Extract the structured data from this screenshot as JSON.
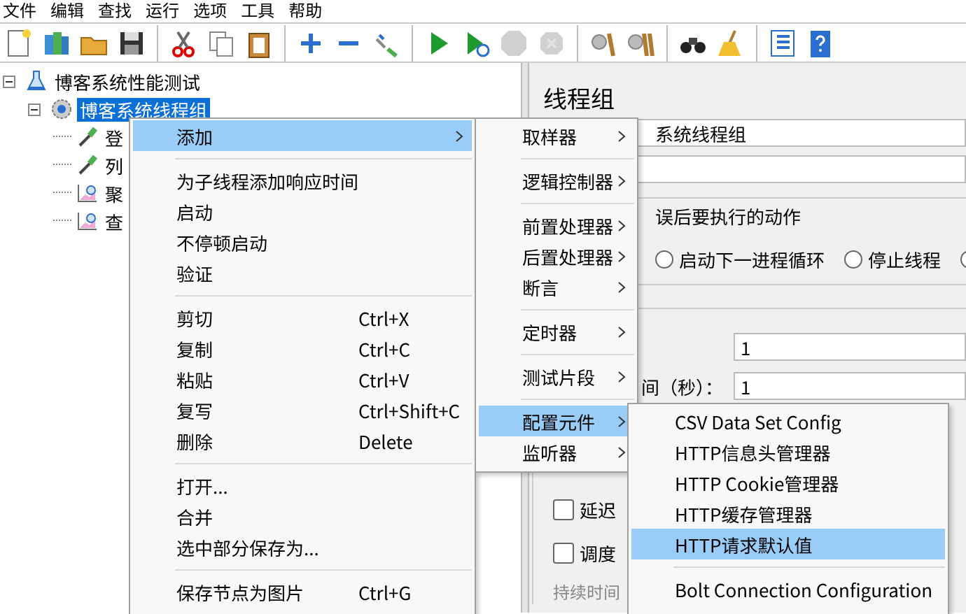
{
  "menu_bar": [
    "文件",
    "编辑",
    "查找",
    "运行",
    "选项",
    "工具",
    "帮助"
  ],
  "toolbar": [
    {
      "disabled": false
    },
    {
      "disabled": false
    },
    {
      "disabled": false
    },
    {
      "disabled": false
    },
    {
      "disabled": false
    },
    {
      "disabled": false
    },
    {
      "disabled": false
    },
    {
      "disabled": false
    },
    {
      "disabled": false
    },
    {
      "disabled": false
    },
    {
      "disabled": false
    },
    {
      "disabled": false
    },
    {
      "disabled": true
    },
    {
      "disabled": true
    },
    {
      "disabled": false
    },
    {
      "disabled": false
    },
    {
      "disabled": false
    },
    {
      "disabled": false
    },
    {
      "disabled": false
    },
    {
      "disabled": false
    }
  ],
  "tree": [
    {
      "kind": "test-plan",
      "label": "博客系统性能测试",
      "expanded": true,
      "selected": false,
      "children": [
        {
          "kind": "thread-group",
          "label": "博客系统线程组",
          "expanded": true,
          "selected": true,
          "children": [
            {
              "kind": "sampler",
              "label": "登",
              "selected": false
            },
            {
              "kind": "sampler",
              "label": "列",
              "selected": false
            },
            {
              "kind": "listener",
              "label": "聚",
              "selected": false
            },
            {
              "kind": "listener",
              "label": "查",
              "selected": false
            }
          ]
        }
      ]
    }
  ],
  "panel": {
    "title": "线程组",
    "name_value": "系统线程组",
    "error_group_title": "误后要执行的动作",
    "radios": [
      {
        "label": "启动下一进程循环",
        "selected": false
      },
      {
        "label": "停止线程",
        "selected": false
      },
      {
        "selected": false
      }
    ],
    "thread_count_value": "1",
    "ramp_label": "间（秒）：",
    "ramp_value": "1",
    "checkboxes": [
      {
        "label": "延迟",
        "checked": false
      },
      {
        "label": "调度",
        "checked": false
      }
    ],
    "duration_label": "持续时间"
  },
  "context_menu": {
    "items": [
      {
        "kind": "item",
        "label": "添加",
        "has_submenu": true,
        "selected": true
      },
      {
        "kind": "separator"
      },
      {
        "kind": "item",
        "label": "为子线程添加响应时间",
        "selected": false
      },
      {
        "kind": "item",
        "label": "启动",
        "selected": false
      },
      {
        "kind": "item",
        "label": "不停顿启动",
        "selected": false
      },
      {
        "kind": "item",
        "label": "验证",
        "selected": false
      },
      {
        "kind": "separator"
      },
      {
        "kind": "item",
        "label": "剪切",
        "shortcut": "Ctrl+X",
        "selected": false
      },
      {
        "kind": "item",
        "label": "复制",
        "shortcut": "Ctrl+C",
        "selected": false
      },
      {
        "kind": "item",
        "label": "粘贴",
        "shortcut": "Ctrl+V",
        "selected": false
      },
      {
        "kind": "item",
        "label": "复写",
        "shortcut": "Ctrl+Shift+C",
        "selected": false
      },
      {
        "kind": "item",
        "label": "删除",
        "shortcut": "Delete",
        "selected": false
      },
      {
        "kind": "separator"
      },
      {
        "kind": "item",
        "label": "打开...",
        "selected": false
      },
      {
        "kind": "item",
        "label": "合并",
        "selected": false
      },
      {
        "kind": "item",
        "label": "选中部分保存为...",
        "selected": false
      },
      {
        "kind": "separator"
      },
      {
        "kind": "item",
        "label": "保存节点为图片",
        "shortcut": "Ctrl+G",
        "selected": false
      }
    ]
  },
  "add_submenu": {
    "items": [
      {
        "kind": "item",
        "label": "取样器",
        "has_submenu": true,
        "selected": false
      },
      {
        "kind": "separator"
      },
      {
        "kind": "item",
        "label": "逻辑控制器",
        "has_submenu": true,
        "selected": false
      },
      {
        "kind": "separator"
      },
      {
        "kind": "item",
        "label": "前置处理器",
        "has_submenu": true,
        "selected": false
      },
      {
        "kind": "item",
        "label": "后置处理器",
        "has_submenu": true,
        "selected": false
      },
      {
        "kind": "item",
        "label": "断言",
        "has_submenu": true,
        "selected": false
      },
      {
        "kind": "separator"
      },
      {
        "kind": "item",
        "label": "定时器",
        "has_submenu": true,
        "selected": false
      },
      {
        "kind": "separator"
      },
      {
        "kind": "item",
        "label": "测试片段",
        "has_submenu": true,
        "selected": false
      },
      {
        "kind": "separator"
      },
      {
        "kind": "item",
        "label": "配置元件",
        "has_submenu": true,
        "selected": true
      },
      {
        "kind": "item",
        "label": "监听器",
        "has_submenu": true,
        "selected": false
      }
    ]
  },
  "config_submenu": {
    "items": [
      {
        "kind": "item",
        "label": "CSV Data Set Config",
        "selected": false
      },
      {
        "kind": "item",
        "label": "HTTP信息头管理器",
        "selected": false
      },
      {
        "kind": "item",
        "label": "HTTP Cookie管理器",
        "selected": false
      },
      {
        "kind": "item",
        "label": "HTTP缓存管理器",
        "selected": false
      },
      {
        "kind": "item",
        "label": "HTTP请求默认值",
        "selected": true
      },
      {
        "kind": "separator"
      },
      {
        "kind": "item",
        "label": "Bolt Connection Configuration",
        "selected": false
      }
    ]
  }
}
